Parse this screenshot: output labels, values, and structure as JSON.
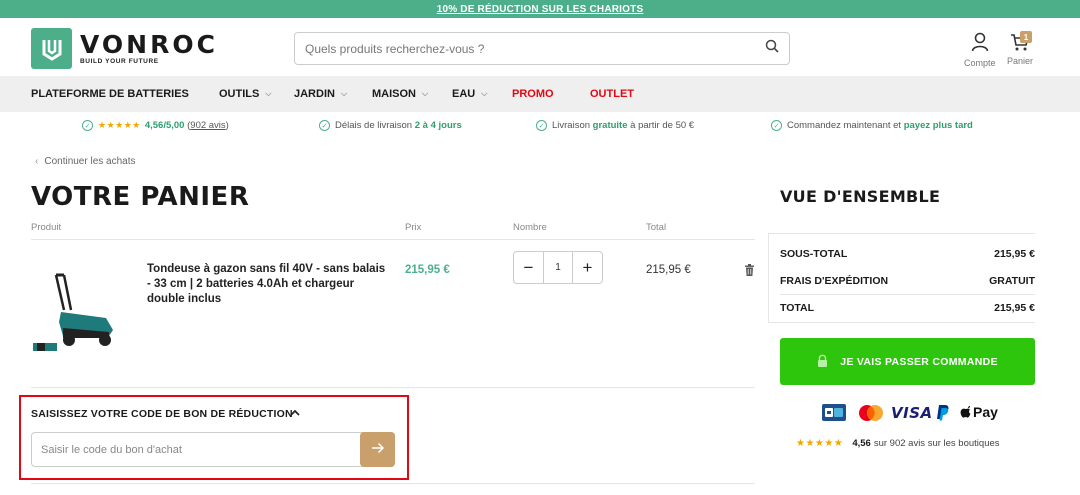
{
  "promo_bar": {
    "text": "10% DE RÉDUCTION SUR LES CHARIOTS"
  },
  "header": {
    "logo_name": "VONROC",
    "logo_tagline": "BUILD YOUR FUTURE",
    "search_placeholder": "Quels produits recherchez-vous ?",
    "account_label": "Compte",
    "cart_label": "Panier",
    "cart_count": "1"
  },
  "nav": {
    "items": [
      {
        "label": "PLATEFORME DE BATTERIES",
        "dropdown": false
      },
      {
        "label": "OUTILS",
        "dropdown": true
      },
      {
        "label": "JARDIN",
        "dropdown": true
      },
      {
        "label": "MAISON",
        "dropdown": true
      },
      {
        "label": "EAU",
        "dropdown": true
      },
      {
        "label": "PROMO",
        "dropdown": false,
        "color": "#e30613"
      },
      {
        "label": "OUTLET",
        "dropdown": false,
        "color": "#e30613"
      }
    ]
  },
  "usps": {
    "rating_score": "4,56/5,00",
    "rating_reviews": "902 avis",
    "delivery_text": "Délais de livraison",
    "delivery_bold": "2 à 4 jours",
    "free_text_1": "Livraison",
    "free_bold": "gratuite",
    "free_text_2": "à partir de 50 €",
    "paylater_text": "Commandez maintenant et",
    "paylater_bold": "payez plus tard"
  },
  "cart": {
    "continue_label": "Continuer les achats",
    "title": "VOTRE PANIER",
    "columns": {
      "product": "Produit",
      "price": "Prix",
      "quantity": "Nombre",
      "total": "Total"
    },
    "items": [
      {
        "name": "Tondeuse à gazon sans fil 40V - sans balais - 33 cm | 2 batteries 4.0Ah et chargeur double inclus",
        "price": "215,95 €",
        "quantity": "1",
        "total": "215,95 €"
      }
    ],
    "coupon": {
      "title": "SAISISSEZ VOTRE CODE DE BON DE RÉDUCTION",
      "placeholder": "Saisir le code du bon d'achat"
    }
  },
  "overview": {
    "title": "VUE D'ENSEMBLE",
    "subtotal_label": "SOUS-TOTAL",
    "subtotal_value": "215,95 €",
    "shipping_label": "FRAIS D'EXPÉDITION",
    "shipping_value": "GRATUIT",
    "total_label": "TOTAL",
    "total_value": "215,95 €",
    "checkout_label": "JE VAIS PASSER COMMANDE",
    "payment_methods": [
      "CB",
      "Mastercard",
      "VISA",
      "PayPal",
      "Apple Pay"
    ],
    "visa_text": "VISA",
    "applepay_text": "Pay",
    "shop_rating_score": "4,56",
    "shop_rating_text": "sur 902 avis sur les boutiques"
  },
  "colors": {
    "brand_green": "#4caf8a",
    "cta_green": "#2dc60c",
    "accent_gold": "#c9a06b",
    "promo_red": "#e30613"
  }
}
